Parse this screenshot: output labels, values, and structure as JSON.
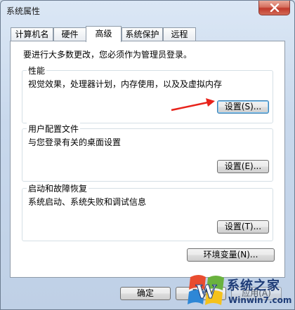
{
  "window": {
    "title": "系统属性"
  },
  "tabs": [
    {
      "label": "计算机名"
    },
    {
      "label": "硬件"
    },
    {
      "label": "高级"
    },
    {
      "label": "系统保护"
    },
    {
      "label": "远程"
    }
  ],
  "admin_note": "要进行大多数更改，您必须作为管理员登录。",
  "performance": {
    "title": "性能",
    "description": "视觉效果，处理器计划，内存使用，以及及虚拟内存",
    "button": "设置(S)..."
  },
  "user_profiles": {
    "title": "用户配置文件",
    "description": "与您登录有关的桌面设置",
    "button": "设置(E)..."
  },
  "startup_recovery": {
    "title": "启动和故障恢复",
    "description": "系统启动、系统失败和调试信息",
    "button": "设置(T)..."
  },
  "env_button": "环境变量(N)...",
  "footer": {
    "ok": "确定",
    "cancel": "取消",
    "apply": "应用(A)"
  },
  "watermark": {
    "line1": "系统之家",
    "line2": "Winwin7.com",
    "logo_letter": "W"
  },
  "colors": {
    "arrow": "#e8231b",
    "close": "#c0392b"
  }
}
